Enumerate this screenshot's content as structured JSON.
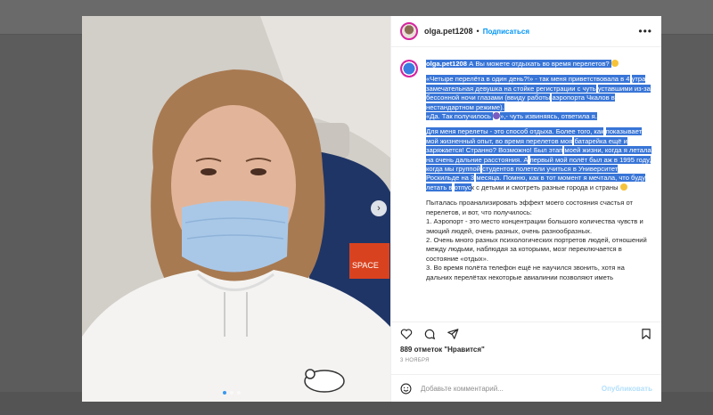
{
  "post": {
    "username": "olga.pet1208",
    "follow_label": "Подписаться",
    "caption_username": "olga.pet1208",
    "caption_lines": [
      "А Вы можете отдыхать во время перелетов?",
      "«Четыре перелёта в один день?!» - так меня приветствовала в 4",
      "утра замечательная девушка на стойке регистрации с чуть",
      "уставшими из-за бессонной ночи глазами (ввиду работы",
      "аэропорта Чкалов в нестандартном режиме).",
      "«Да. Так получилось",
      "»,- чуть извиняясь, ответила я.",
      "Для меня перелеты - это способ отдыха. Более того, как",
      "показывает мой жизненный опыт, во время перелетов моя",
      "батарейка ещё и заряжается! Странно? Возможно! Был этап",
      "моей жизни, когда я летала на очень дальние расстояния. А",
      "первый мой полёт был аж в 1995 году, когда мы группой",
      "студентов полетели учиться в Университет Роскильде на 3",
      "месяца. Помню, как в тот момент я мечтала, что буду летать в",
      "отпус",
      "к с детьми и смотреть разные города и страны"
    ],
    "paragraph2": [
      "Пыталась проанализировать эффект моего состояния счастья от",
      "перелетов, и вот, что получилось:",
      "1. Аэропорт - это место концентрации большого количества",
      "чувств и эмоций людей, очень разных, очень разнообразных.",
      "2. Очень много разных психологических портретов людей,",
      "отношений между людьми, наблюдая за которыми, мозг",
      "переключается в состояние «отдых».",
      "3. Во время полёта телефон ещё не научился звонить, хотя на",
      "дальних перелётах некоторые авиалинии позволяют иметь"
    ],
    "likes": "889 отметок \"Нравится\"",
    "date": "3 НОЯБРЯ",
    "comment_placeholder": "Добавьте комментарий...",
    "publish_label": "Опубликовать",
    "more_label": "•••",
    "photo_text": "SPACE",
    "colors": {
      "selection": "#3875d7",
      "link": "#0095f6"
    }
  }
}
